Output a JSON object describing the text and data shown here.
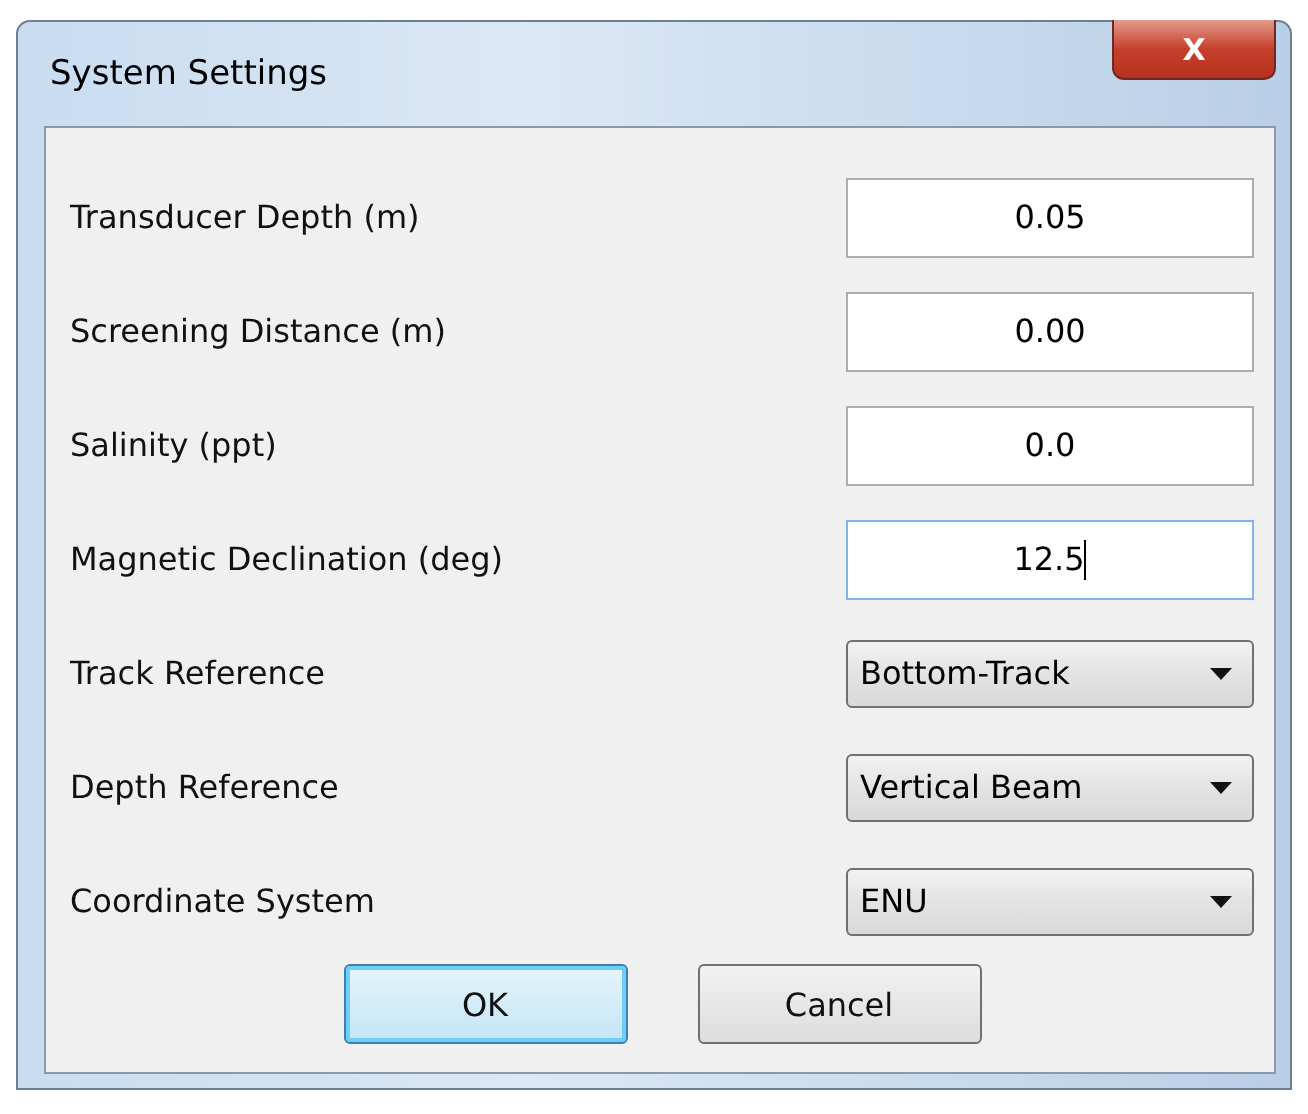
{
  "window": {
    "title": "System Settings",
    "close_label": "X"
  },
  "settings": [
    {
      "label": "Transducer Depth (m)",
      "kind": "text",
      "value": "0.05",
      "focused": false
    },
    {
      "label": "Screening Distance (m)",
      "kind": "text",
      "value": "0.00",
      "focused": false
    },
    {
      "label": "Salinity (ppt)",
      "kind": "text",
      "value": "0.0",
      "focused": false
    },
    {
      "label": "Magnetic Declination (deg)",
      "kind": "text",
      "value": "12.5",
      "focused": true
    },
    {
      "label": "Track Reference",
      "kind": "dropdown",
      "value": "Bottom-Track"
    },
    {
      "label": "Depth Reference",
      "kind": "dropdown",
      "value": "Vertical Beam"
    },
    {
      "label": "Coordinate System",
      "kind": "dropdown",
      "value": "ENU"
    }
  ],
  "buttons": [
    {
      "label": "OK",
      "default": true
    },
    {
      "label": "Cancel",
      "default": false
    }
  ]
}
